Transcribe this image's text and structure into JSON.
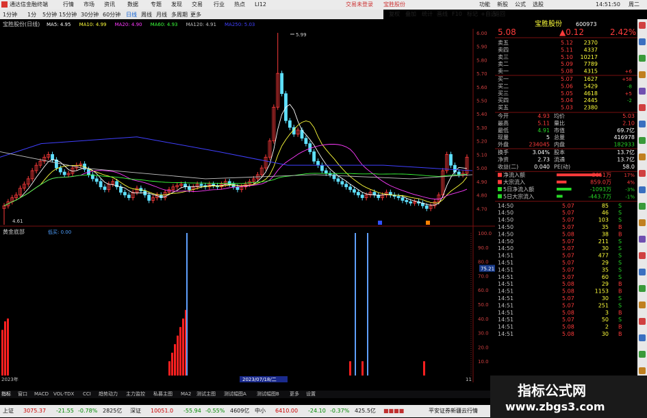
{
  "window": {
    "app_title": "通达信金融终端",
    "status_center": "交易未登录",
    "status_stock": "宝胜股份",
    "time": "14:51:50",
    "weekday": "周二"
  },
  "menu": {
    "items": [
      "行情",
      "市场",
      "资讯",
      "数据",
      "专题",
      "发现",
      "交易",
      "行业",
      "热点",
      "LI12"
    ]
  },
  "toolbar": {
    "periods": [
      "1分钟",
      "1分",
      "5分钟",
      "15分钟",
      "30分钟",
      "60分钟",
      "日线",
      "周线",
      "月线",
      "多周期",
      "更多"
    ],
    "right_buttons": [
      "复权",
      "叠加",
      "统计",
      "画线",
      "F10",
      "标记",
      "+自选",
      "返回"
    ],
    "right_menu": [
      "功能",
      "新股",
      "公式",
      "选股"
    ]
  },
  "chart": {
    "title": "宝胜股份(日线)",
    "ma": [
      {
        "label": "MA5: 4.95",
        "color": "#ffffff"
      },
      {
        "label": "MA10: 4.99",
        "color": "#ffff3b"
      },
      {
        "label": "MA20: 4.90",
        "color": "#ff3bff"
      },
      {
        "label": "MA60: 4.93",
        "color": "#3bff3b"
      },
      {
        "label": "MA120: 4.91",
        "color": "#c0c0c0"
      },
      {
        "label": "MA250: 5.03",
        "color": "#4040ff"
      }
    ],
    "high_label": "5.99",
    "low_label": "4.61",
    "price_ticks": [
      "6.00",
      "5.90",
      "5.80",
      "5.70",
      "5.60",
      "5.50",
      "5.40",
      "5.30",
      "5.20",
      "5.10",
      "5.00",
      "4.90",
      "4.80",
      "4.70"
    ],
    "indicator_title": "黄金底部",
    "indicator_value": "低买: 0.00",
    "ind_ticks": [
      "100.0",
      "90.0",
      "80.0",
      "70.0",
      "60.0",
      "50.0",
      "40.0",
      "30.0",
      "20.0",
      "10.0"
    ],
    "cursor_value": "75.21",
    "date_left": "2023年",
    "date_cursor": "2023/07/18/二",
    "cursor_right_label": "11",
    "ticks_label": "日线"
  },
  "stock": {
    "name": "宝胜股份",
    "code": "600973",
    "price": "5.08",
    "change": "▲0.12",
    "pct": "2.42%"
  },
  "order_book": [
    {
      "l": "卖五",
      "p": "5.12",
      "v": "2370",
      "c": "red"
    },
    {
      "l": "卖四",
      "p": "5.11",
      "v": "4337",
      "c": "red"
    },
    {
      "l": "卖三",
      "p": "5.10",
      "v": "10217",
      "c": "red"
    },
    {
      "l": "卖二",
      "p": "5.09",
      "v": "7789",
      "c": "red"
    },
    {
      "l": "卖一",
      "p": "5.08",
      "v": "4315",
      "c": "red",
      "d": "+6"
    },
    {
      "l": "买一",
      "p": "5.07",
      "v": "1627",
      "c": "red",
      "d": "+58"
    },
    {
      "l": "买二",
      "p": "5.06",
      "v": "5429",
      "c": "red",
      "d": "-8"
    },
    {
      "l": "买三",
      "p": "5.05",
      "v": "4618",
      "c": "red",
      "d": "+5"
    },
    {
      "l": "买四",
      "p": "5.04",
      "v": "2445",
      "c": "red",
      "d": "-2"
    },
    {
      "l": "买五",
      "p": "5.03",
      "v": "2380",
      "c": "red"
    }
  ],
  "quote": [
    {
      "a": "今开",
      "av": "4.93",
      "ac": "red",
      "b": "均价",
      "bv": "5.03",
      "bc": "red"
    },
    {
      "a": "最高",
      "av": "5.11",
      "ac": "red",
      "b": "量比",
      "bv": "2.10",
      "bc": "red"
    },
    {
      "a": "最低",
      "av": "4.91",
      "ac": "green",
      "b": "市值",
      "bv": "69.7亿",
      "bc": "white"
    },
    {
      "a": "现量",
      "av": "5",
      "ac": "white",
      "b": "总量",
      "bv": "416978",
      "bc": "white"
    },
    {
      "a": "外盘",
      "av": "234045",
      "ac": "red",
      "b": "内盘",
      "bv": "182933",
      "bc": "green"
    },
    {
      "a": "换手",
      "av": "3.04%",
      "ac": "white",
      "b": "股本",
      "bv": "13.7亿",
      "bc": "white"
    },
    {
      "a": "净资",
      "av": "2.73",
      "ac": "white",
      "b": "流通",
      "bv": "13.7亿",
      "bc": "white"
    },
    {
      "a": "收益(二)",
      "av": "0.040",
      "ac": "white",
      "b": "PE(动)",
      "bv": "58.0",
      "bc": "white"
    }
  ],
  "flows": [
    {
      "l": "净流入额",
      "v": "3651万",
      "p": "17%",
      "c": "red",
      "w": 0.9
    },
    {
      "l": "大宗流入",
      "v": "859.0万",
      "p": "4%",
      "c": "red",
      "w": 0.2
    },
    {
      "l": "5日净流入额",
      "v": "-1093万",
      "p": "-3%",
      "c": "green",
      "w": 0.3
    },
    {
      "l": "5日大宗流入",
      "v": "-443.7万",
      "p": "-1%",
      "c": "green",
      "w": 0.12
    }
  ],
  "ticks": [
    [
      "14:50",
      "5.07",
      "85",
      "S"
    ],
    [
      "14:50",
      "5.07",
      "46",
      "S"
    ],
    [
      "14:50",
      "5.07",
      "103",
      "S"
    ],
    [
      "14:50",
      "5.07",
      "35",
      "B"
    ],
    [
      "14:50",
      "5.08",
      "38",
      "B"
    ],
    [
      "14:50",
      "5.07",
      "211",
      "S"
    ],
    [
      "14:50",
      "5.07",
      "30",
      "S"
    ],
    [
      "14:51",
      "5.07",
      "477",
      "S"
    ],
    [
      "14:51",
      "5.07",
      "29",
      "S"
    ],
    [
      "14:51",
      "5.07",
      "35",
      "S"
    ],
    [
      "14:51",
      "5.07",
      "60",
      "S"
    ],
    [
      "14:51",
      "5.08",
      "29",
      "B"
    ],
    [
      "14:51",
      "5.08",
      "1153",
      "B"
    ],
    [
      "14:51",
      "5.07",
      "30",
      "S"
    ],
    [
      "14:51",
      "5.07",
      "251",
      "S"
    ],
    [
      "14:51",
      "5.08",
      "3",
      "B"
    ],
    [
      "14:51",
      "5.07",
      "50",
      "S"
    ],
    [
      "14:51",
      "5.08",
      "2",
      "B"
    ],
    [
      "14:51",
      "5.08",
      "30",
      "B"
    ]
  ],
  "bottom_tabs": [
    "指标",
    "窗口",
    "MACD",
    "VOL-TDX",
    "CCI",
    "趋势动力",
    "主力监控",
    "私募主图",
    "MA2",
    "测试主图",
    "测试幅图A",
    "测试幅图B",
    "更多",
    "设置"
  ],
  "right_bottom": {
    "left": "日线",
    "tab1": "模板",
    "tab2": "笔"
  },
  "status": {
    "sh": {
      "n": "上证",
      "v": "3075.37",
      "c": "-21.55",
      "p": "-0.78%",
      "a": "2825亿"
    },
    "sz": {
      "n": "深证",
      "v": "10051.0",
      "c": "-55.94",
      "p": "-0.55%",
      "a": "4609亿"
    },
    "zx": {
      "n": "中小",
      "v": "6410.00",
      "c": "-24.10",
      "p": "-0.37%",
      "a": "425.5亿"
    },
    "broker": "平安证券新疆云行情"
  },
  "watermark": {
    "title": "指标公式网",
    "url": "www.zbgs3.com"
  }
}
